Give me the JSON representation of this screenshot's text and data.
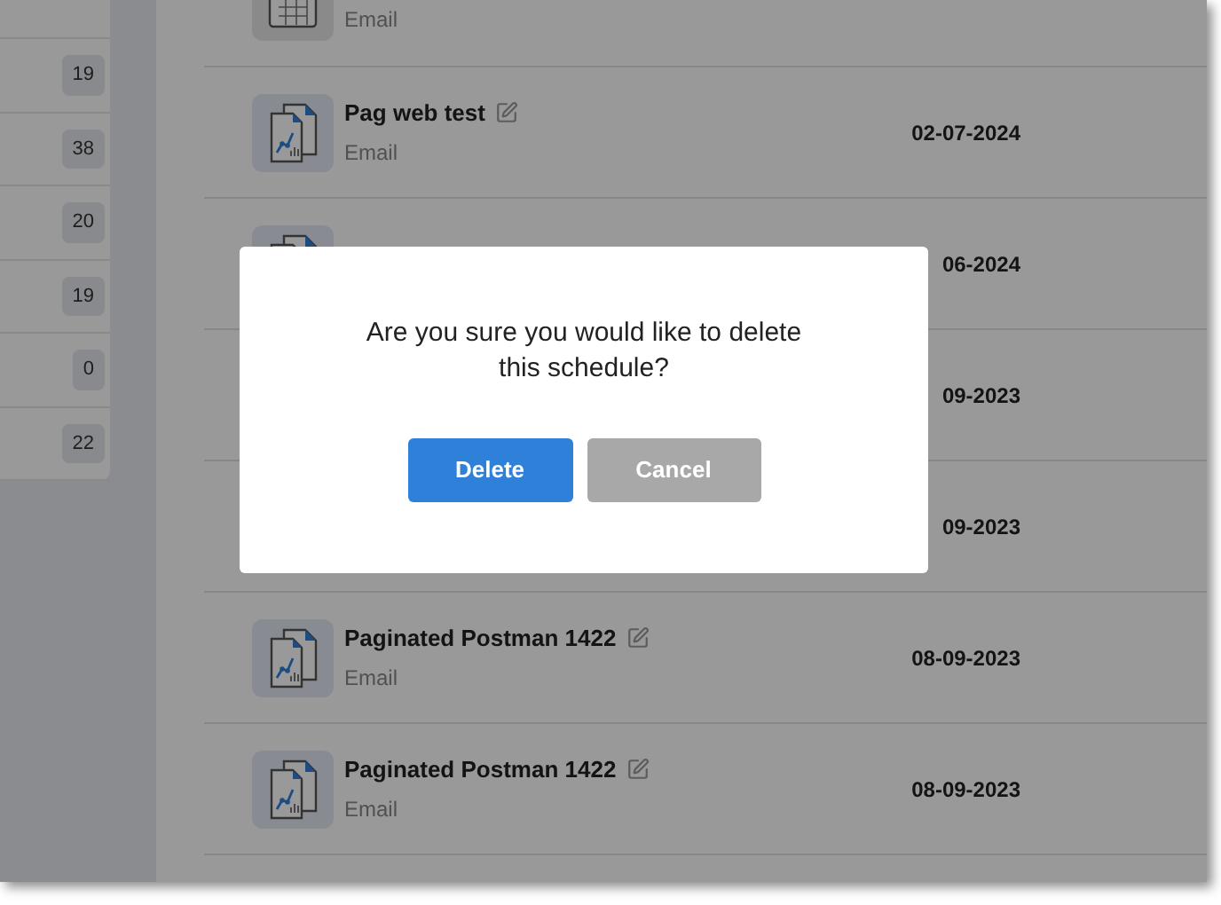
{
  "sidebar": {
    "counts": [
      "19",
      "38",
      "20",
      "19",
      "0",
      "22"
    ]
  },
  "schedules": [
    {
      "kind": "calendar",
      "subtitle": "Email"
    },
    {
      "kind": "report",
      "name": "Pag web test",
      "subtitle": "Email",
      "date": "02-07-2024"
    },
    {
      "kind": "report",
      "date": "06-2024"
    },
    {
      "date": "09-2023"
    },
    {
      "date": "09-2023"
    },
    {
      "kind": "report",
      "name": "Paginated Postman 1422",
      "subtitle": "Email",
      "date": "08-09-2023"
    },
    {
      "kind": "report",
      "name": "Paginated Postman 1422",
      "subtitle": "Email",
      "date": "08-09-2023"
    }
  ],
  "dialog": {
    "message": "Are you sure you would like to delete this schedule?",
    "buttons": [
      {
        "label": "Delete",
        "kind": "primary"
      },
      {
        "label": "Cancel",
        "kind": "secondary"
      }
    ]
  }
}
